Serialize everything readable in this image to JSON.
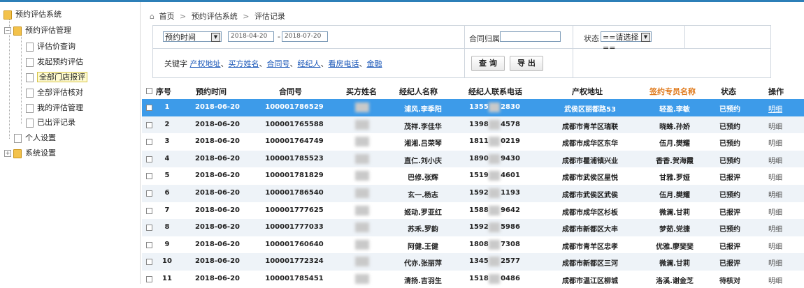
{
  "sidebar": {
    "root": "预约评估系统",
    "group": "预约评估管理",
    "items": [
      "评估价查询",
      "发起预约评估",
      "全部门店报评",
      "全部评估核对",
      "我的评估管理",
      "已出评记录"
    ],
    "active_index": 2,
    "personal": "个人设置",
    "system": "系统设置",
    "expand_minus": "−",
    "expand_plus": "+"
  },
  "breadcrumb": {
    "home": "首页",
    "level1": "预约评估系统",
    "level2": "评估记录",
    "sep": ">"
  },
  "filter": {
    "time_type": "预约时间",
    "date_from": "2018-04-20",
    "date_sep": "-",
    "date_to": "2018-07-20",
    "contract_owner_label": "合同归属",
    "contract_owner_value": "",
    "status_label": "状态",
    "status_value": "==请选择==",
    "keyword_label": "关键字",
    "keyword_links": [
      "产权地址",
      "买方姓名",
      "合同号",
      "经纪人",
      "看房电话",
      "金融"
    ],
    "keyword_sep": "、",
    "search_button": "查 询",
    "export_button": "导 出",
    "arrow": "▼"
  },
  "table": {
    "columns": [
      "序号",
      "预约时间",
      "合同号",
      "买方姓名",
      "经纪人名称",
      "经纪人联系电话",
      "产权地址",
      "签约专员名称",
      "状态",
      "操作"
    ],
    "rows": [
      {
        "no": "1",
        "time": "2018-06-20",
        "contract": "100001786529",
        "agent": "浦风.李季阳",
        "phone_a": "1355",
        "phone_b": "2830",
        "addr": "武侯区丽都路53",
        "rep": "轻盈.李敏",
        "status": "已预约",
        "op": "明细"
      },
      {
        "no": "2",
        "time": "2018-06-20",
        "contract": "100001765588",
        "agent": "茂祥.李佳华",
        "phone_a": "1398",
        "phone_b": "4578",
        "addr": "成都市青羊区瑞联",
        "rep": "晓蛛.孙娇",
        "status": "已预约",
        "op": "明细"
      },
      {
        "no": "3",
        "time": "2018-06-20",
        "contract": "100001764749",
        "agent": "湘湘.吕荣琴",
        "phone_a": "1811",
        "phone_b": "0219",
        "addr": "成都市成华区东华",
        "rep": "伍月.樊耀",
        "status": "已预约",
        "op": "明细"
      },
      {
        "no": "4",
        "time": "2018-06-20",
        "contract": "100001785523",
        "agent": "直仁.刘小庆",
        "phone_a": "1890",
        "phone_b": "9430",
        "addr": "成都市瞿浦镇兴业",
        "rep": "香香.贺海霞",
        "status": "已预约",
        "op": "明细"
      },
      {
        "no": "5",
        "time": "2018-06-20",
        "contract": "100001781829",
        "agent": "巴修.张辉",
        "phone_a": "1519",
        "phone_b": "4601",
        "addr": "成都市武侯区星悦",
        "rep": "甘雅.罗娅",
        "status": "已报评",
        "op": "明细"
      },
      {
        "no": "6",
        "time": "2018-06-20",
        "contract": "100001786540",
        "agent": "玄一.杨志",
        "phone_a": "1592",
        "phone_b": "1193",
        "addr": "成都市武侯区武侯",
        "rep": "伍月.樊耀",
        "status": "已预约",
        "op": "明细"
      },
      {
        "no": "7",
        "time": "2018-06-20",
        "contract": "100001777625",
        "agent": "姬动.罗亚红",
        "phone_a": "1588",
        "phone_b": "9642",
        "addr": "成都市成华区杉板",
        "rep": "微澜.甘莉",
        "status": "已报评",
        "op": "明细"
      },
      {
        "no": "8",
        "time": "2018-06-20",
        "contract": "100001777033",
        "agent": "苏禾.罗韵",
        "phone_a": "1592",
        "phone_b": "5986",
        "addr": "成都市新都区大丰",
        "rep": "梦茹.党捷",
        "status": "已预约",
        "op": "明细"
      },
      {
        "no": "9",
        "time": "2018-06-20",
        "contract": "100001760640",
        "agent": "阿健.王健",
        "phone_a": "1808",
        "phone_b": "7308",
        "addr": "成都市青羊区忠孝",
        "rep": "优雅.廖斐斐",
        "status": "已报评",
        "op": "明细"
      },
      {
        "no": "10",
        "time": "2018-06-20",
        "contract": "100001772324",
        "agent": "代亦.张丽萍",
        "phone_a": "1345",
        "phone_b": "2577",
        "addr": "成都市新都区三河",
        "rep": "微澜.甘莉",
        "status": "已报评",
        "op": "明细"
      },
      {
        "no": "11",
        "time": "2018-06-20",
        "contract": "100001785451",
        "agent": "清扬.吉羽生",
        "phone_a": "1518",
        "phone_b": "0486",
        "addr": "成都市温江区柳城",
        "rep": "洛溪.谢金芝",
        "status": "待核对",
        "op": "明细"
      }
    ]
  },
  "colors": {
    "selected_row": "#3d9be9",
    "even_row": "#eef3f8",
    "odd_row": "#ffffff",
    "rep_header": "#e07a1c",
    "link": "#1a57b8"
  }
}
